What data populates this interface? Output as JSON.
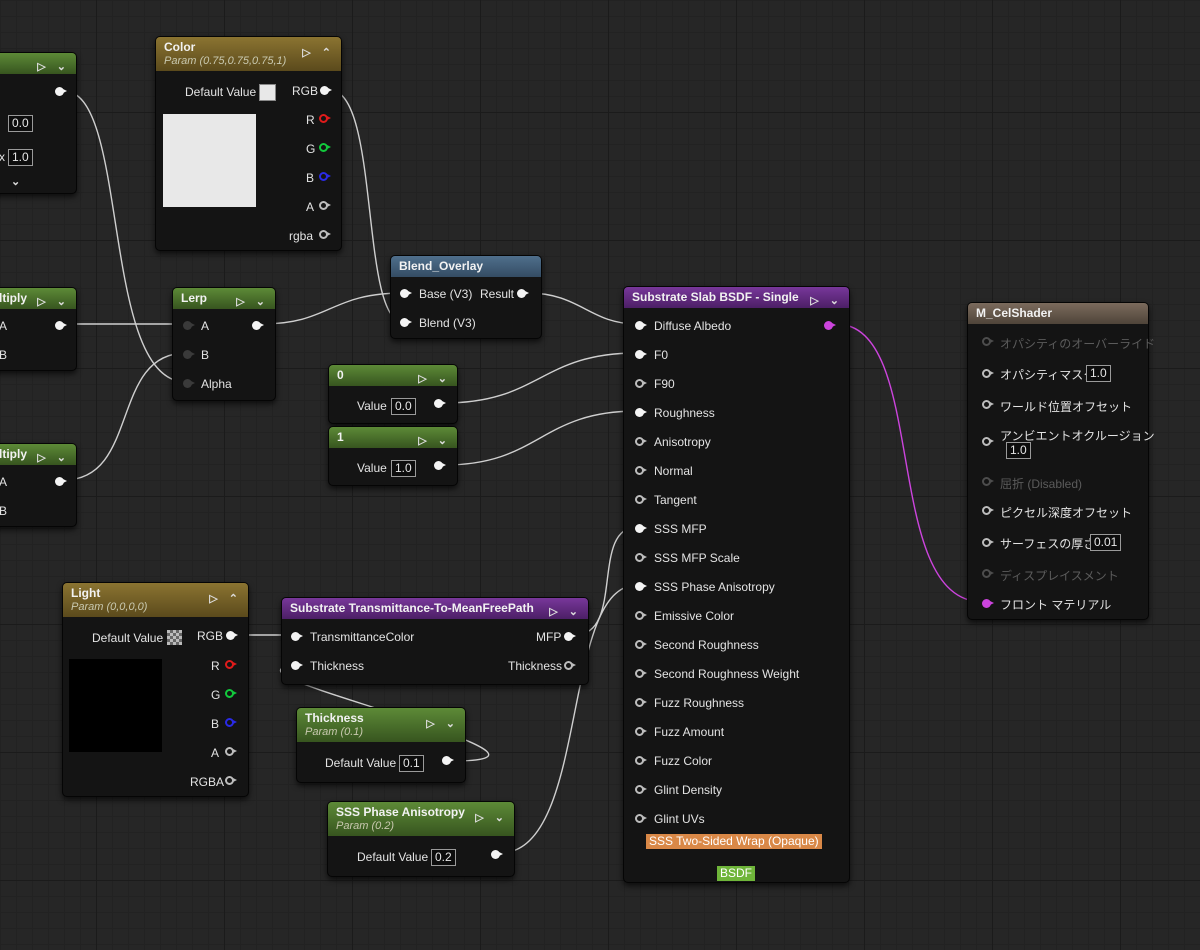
{
  "colors": {
    "wire": "#cfcfcf",
    "wire_purple": "#cc44dd",
    "sss_badge": "#d98847",
    "bsdf_badge": "#6fb53a"
  },
  "nodes": {
    "partial_top": {
      "value_a": "0.0",
      "label_b": "x",
      "value_b": "1.0"
    },
    "multiply1": {
      "title": "ltiply",
      "pin_a": "A",
      "pin_b": "B"
    },
    "multiply2": {
      "title": "ltiply",
      "pin_a": "A",
      "pin_b": "B"
    },
    "color": {
      "title": "Color",
      "subtitle": "Param (0.75,0.75,0.75,1)",
      "default_label": "Default Value",
      "preview_color": "#e8e8e8",
      "pins": {
        "rgb": "RGB",
        "r": "R",
        "g": "G",
        "b": "B",
        "a": "A",
        "rgba": "rgba"
      }
    },
    "lerp": {
      "title": "Lerp",
      "pins": {
        "a": "A",
        "b": "B",
        "alpha": "Alpha"
      }
    },
    "blend": {
      "title": "Blend_Overlay",
      "base": "Base (V3)",
      "blend": "Blend (V3)",
      "result": "Result"
    },
    "const0": {
      "title": "0",
      "label": "Value",
      "value": "0.0"
    },
    "const1": {
      "title": "1",
      "label": "Value",
      "value": "1.0"
    },
    "light": {
      "title": "Light",
      "subtitle": "Param (0,0,0,0)",
      "default_label": "Default Value",
      "preview_color": "#000000",
      "pins": {
        "rgb": "RGB",
        "r": "R",
        "g": "G",
        "b": "B",
        "a": "A",
        "rgba": "RGBA"
      }
    },
    "transmittance": {
      "title": "Substrate Transmittance-To-MeanFreePath",
      "in1": "TransmittanceColor",
      "in2": "Thickness",
      "out1": "MFP",
      "out2": "Thickness"
    },
    "thickness": {
      "title": "Thickness",
      "subtitle": "Param (0.1)",
      "label": "Default Value",
      "value": "0.1"
    },
    "sss_phase": {
      "title": "SSS Phase Anisotropy",
      "subtitle": "Param (0.2)",
      "label": "Default Value",
      "value": "0.2"
    },
    "slab": {
      "title": "Substrate Slab BSDF - Single",
      "inputs": [
        "Diffuse Albedo",
        "F0",
        "F90",
        "Roughness",
        "Anisotropy",
        "Normal",
        "Tangent",
        "SSS MFP",
        "SSS MFP Scale",
        "SSS Phase Anisotropy",
        "Emissive Color",
        "Second Roughness",
        "Second Roughness Weight",
        "Fuzz Roughness",
        "Fuzz Amount",
        "Fuzz Color",
        "Glint Density",
        "Glint UVs"
      ],
      "sss_badge": "SSS Two-Sided Wrap (Opaque)",
      "bsdf_badge": "BSDF"
    },
    "material": {
      "title": "M_CelShader",
      "inputs": [
        "オパシティのオーバーライド",
        "オパシティマスク",
        "ワールド位置オフセット",
        "アンビエントオクルージョン",
        "屈折 (Disabled)",
        "ピクセル深度オフセット",
        "サーフェスの厚さ",
        "ディスプレイスメント",
        "フロント マテリアル"
      ],
      "opacity_mask_value": "1.0",
      "ao_value": "1.0",
      "surface_thickness_value": "0.01"
    }
  }
}
